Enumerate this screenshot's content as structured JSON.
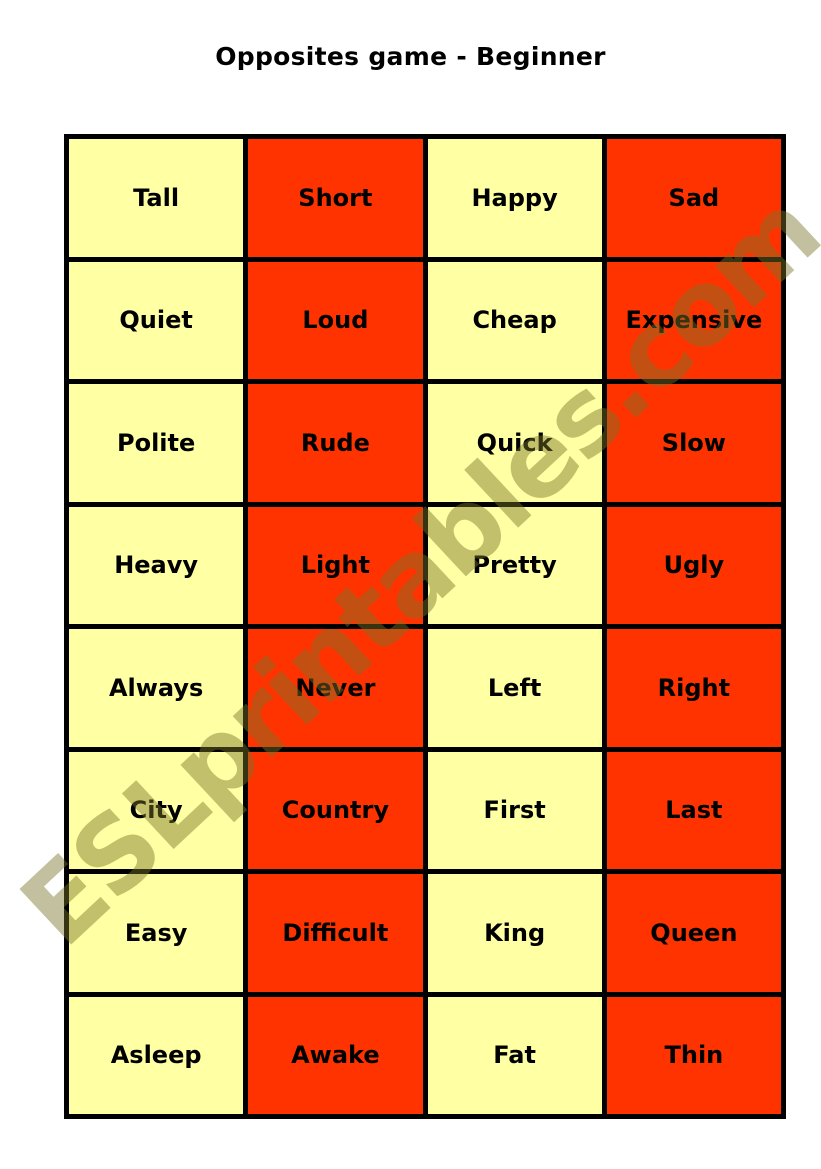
{
  "title": "Opposites game - Beginner",
  "colors": {
    "light": "#FFFFA3",
    "dark": "#FF3300",
    "border": "#000000"
  },
  "rows": [
    [
      "Tall",
      "Short",
      "Happy",
      "Sad"
    ],
    [
      "Quiet",
      "Loud",
      "Cheap",
      "Expensive"
    ],
    [
      "Polite",
      "Rude",
      "Quick",
      "Slow"
    ],
    [
      "Heavy",
      "Light",
      "Pretty",
      "Ugly"
    ],
    [
      "Always",
      "Never",
      "Left",
      "Right"
    ],
    [
      "City",
      "Country",
      "First",
      "Last"
    ],
    [
      "Easy",
      "Difficult",
      "King",
      "Queen"
    ],
    [
      "Asleep",
      "Awake",
      "Fat",
      "Thin"
    ]
  ],
  "watermark": "ESLprintables.com"
}
